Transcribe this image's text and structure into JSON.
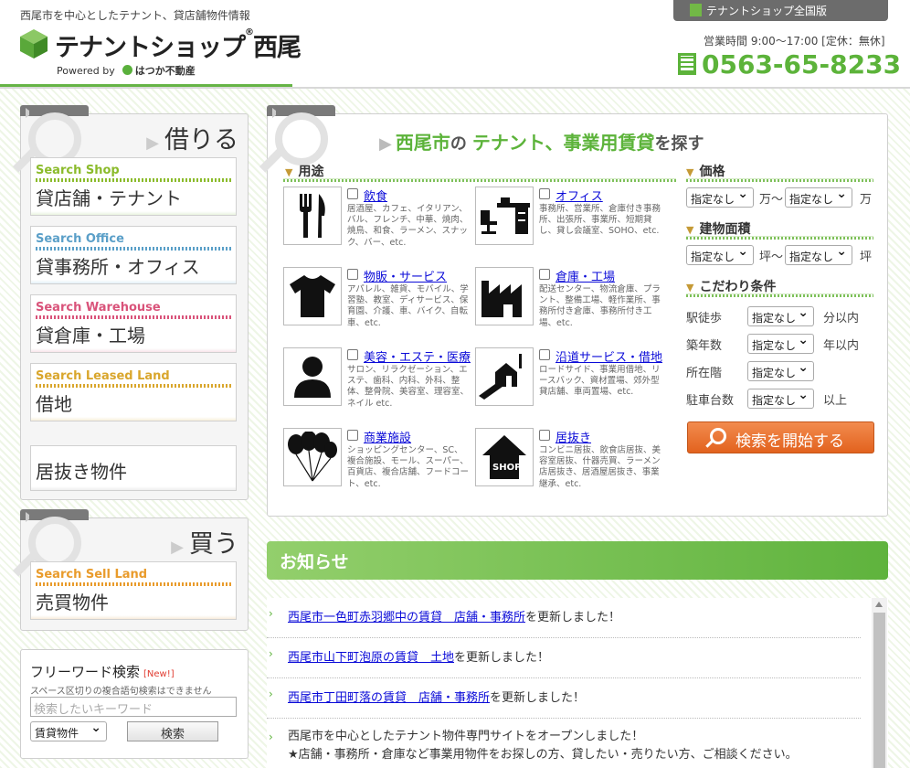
{
  "header": {
    "tagline": "西尾市を中心としたテナント、貸店舗物件情報",
    "logo_text": "テナントショップ",
    "logo_suffix": "西尾",
    "powered_by": "Powered by",
    "company": "はつか不動産",
    "top_button": "テナントショップ全国版",
    "hours": "営業時間 9:00～17:00 [定休：無休]",
    "phone": "0563-65-8233"
  },
  "rent_panel": {
    "title": "借りる",
    "items": [
      {
        "en": "Search Shop",
        "jp": "貸店舗・テナント",
        "color": "#8bbb2b"
      },
      {
        "en": "Search Office",
        "jp": "貸事務所・オフィス",
        "color": "#5a9fc8"
      },
      {
        "en": "Search Warehouse",
        "jp": "貸倉庫・工場",
        "color": "#d9537a"
      },
      {
        "en": "Search Leased Land",
        "jp": "借地",
        "color": "#d9a62c"
      }
    ],
    "extra": "居抜き物件"
  },
  "buy_panel": {
    "title": "買う",
    "item": {
      "en": "Search Sell Land",
      "jp": "売買物件",
      "color": "#e99b2b"
    }
  },
  "freeword": {
    "title": "フリーワード検索",
    "new_badge": "[New!]",
    "note": "スペース区切りの複合語句検索はできません",
    "placeholder": "検索したいキーワード",
    "select_value": "賃貸物件",
    "button": "検索"
  },
  "search": {
    "title_a": "西尾市",
    "title_b": "の",
    "title_c": "テナント、事業用賃貸",
    "title_d": "を探す",
    "use_head": "用途",
    "uses": [
      {
        "label": "飲食",
        "desc": "居酒屋、カフェ、イタリアン、バル、フレンチ、中華、焼肉、焼鳥、和食、ラーメン、スナック、バー、etc.",
        "icon": "restaurant-icon"
      },
      {
        "label": "オフィス",
        "desc": "事務所、営業所、倉庫付き事務所、出張所、事業所、短期貸し、貸し会議室、SOHO、etc.",
        "icon": "office-desk-icon"
      },
      {
        "label": "物販・サービス",
        "desc": "アパレル、雑貨、モバイル、学習塾、教室、ディサービス、保育園、介護、車、バイク、自転車、etc.",
        "icon": "tshirt-icon"
      },
      {
        "label": "倉庫・工場",
        "desc": "配送センター、物流倉庫、プラント、整備工場、軽作業所、事務所付き倉庫、事務所付き工場、etc.",
        "icon": "factory-icon"
      },
      {
        "label": "美容・エステ・医療",
        "desc": "サロン、リラクゼーション、エステ、歯科、内科、外科、整体、整骨院、美容室、理容室、ネイル etc.",
        "icon": "person-icon"
      },
      {
        "label": "沿道サービス・借地",
        "desc": "ロードサイド、事業用借地、リースバック、資材置場、郊外型貸店舗、車両置場、etc.",
        "icon": "roadside-icon"
      },
      {
        "label": "商業施設",
        "desc": "ショッピングセンター、SC、複合施設、モール、スーパー、百貨店、複合店舗、フードコート、etc.",
        "icon": "balloons-icon"
      },
      {
        "label": "居抜き",
        "desc": "コンビニ居抜、飲食店居抜、美容室居抜、什器売買、ラーメン店居抜き、居酒屋居抜き、事業継承、etc.",
        "icon": "shop-house-icon"
      }
    ],
    "price_head": "価格",
    "area_head": "建物面積",
    "cond_head": "こだわり条件",
    "unset": "指定なし",
    "man": "万",
    "man_tilde": "万～",
    "tsubo": "坪",
    "tsubo_tilde": "坪～",
    "conditions": [
      {
        "label": "駅徒歩",
        "suffix": "分以内"
      },
      {
        "label": "築年数",
        "suffix": "年以内"
      },
      {
        "label": "所在階",
        "suffix": ""
      },
      {
        "label": "駐車台数",
        "suffix": "以上"
      }
    ],
    "start_button": "検索を開始する"
  },
  "news": {
    "title": "お知らせ",
    "items": [
      {
        "link": "西尾市一色町赤羽郷中の賃貸　店舗・事務所",
        "text": "を更新しました！"
      },
      {
        "link": "西尾市山下町泡原の賃貸　土地",
        "text": "を更新しました！"
      },
      {
        "link": "西尾市丁田町落の賃貸　店舗・事務所",
        "text": "を更新しました！"
      }
    ],
    "last_line1": "西尾市を中心としたテナント物件専門サイトをオープンしました！",
    "last_line2": "★店舗・事務所・倉庫など事業用物件をお探しの方、貸したい・売りたい方、ご相談ください。"
  }
}
